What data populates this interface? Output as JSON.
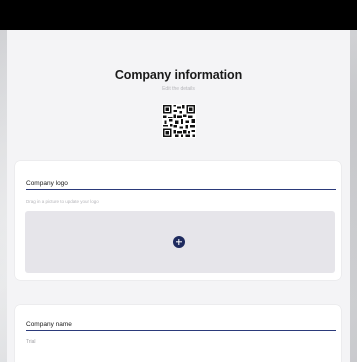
{
  "header": {
    "title": "Company information",
    "subtitle": "Edit the details"
  },
  "qr": {
    "icon": "qr-code-icon"
  },
  "logo_section": {
    "label": "Company logo",
    "hint": "Drag in a picture to update your logo",
    "upload_icon": "plus-circle-icon"
  },
  "name_section": {
    "label": "Company name",
    "value": "Trial"
  },
  "colors": {
    "accent": "#2b3a7a",
    "upload_button": "#1e2a5e",
    "dropzone": "#e6e5ea",
    "top_bar": "#000000"
  }
}
